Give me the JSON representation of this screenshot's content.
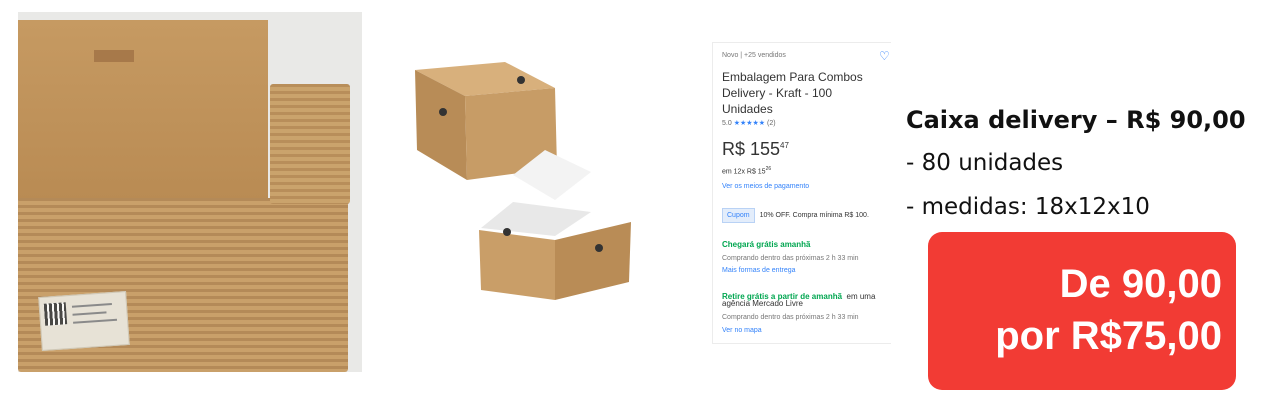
{
  "listing": {
    "meta": "Novo | +25 vendidos",
    "title": "Embalagem Para Combos Delivery - Kraft - 100 Unidades",
    "rating_value": "5.0",
    "rating_stars": "★★★★★",
    "rating_count": "(2)",
    "price_main": "R$ 155",
    "price_cents": "47",
    "installments": "em 12x R$ 15",
    "installments_cents": "26",
    "payment_link": "Ver os meios de pagamento",
    "coupon_tag": "Cupom",
    "coupon_text": "10% OFF. Compra mínima R$ 100.",
    "delivery_title": "Chegará grátis amanhã",
    "delivery_note": "Comprando dentro das próximas 2 h 33 min",
    "delivery_link": "Mais formas de entrega",
    "pickup_title": "Retire grátis a partir de amanhã",
    "pickup_rest": "em uma",
    "pickup_place": "agência Mercado Livre",
    "pickup_note": "Comprando dentro das próximas 2 h 33 min",
    "pickup_link": "Ver no mapa"
  },
  "info": {
    "title": "Caixa delivery – R$ 90,00",
    "quantity": "- 80 unidades",
    "size": "- medidas: 18x12x10"
  },
  "promo": {
    "line1": "De 90,00",
    "line2": "por R$75,00",
    "color": "#f23b34"
  },
  "colors": {
    "kraft": "#c9a06a",
    "link_blue": "#3483fa",
    "free_green": "#00a650"
  },
  "icons": {
    "favorite": "heart-icon",
    "coupon": "coupon-icon"
  }
}
